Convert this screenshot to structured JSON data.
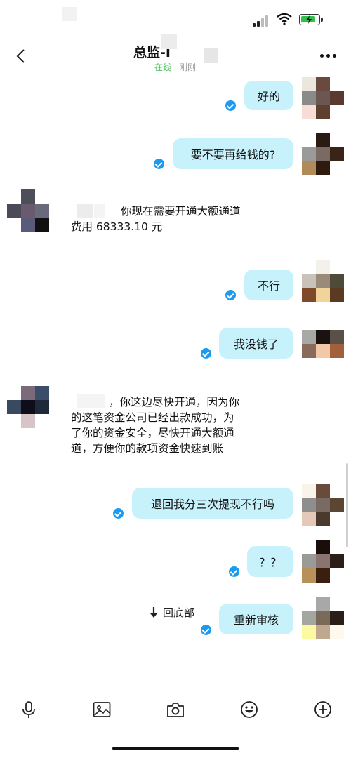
{
  "header": {
    "title": "总监-I",
    "online_status": "在线",
    "last_seen": "刚刚"
  },
  "messages": [
    {
      "side": "out",
      "text": "好的",
      "read": true
    },
    {
      "side": "out",
      "text": "要不要再给钱的?",
      "read": true
    },
    {
      "side": "in",
      "lines": [
        "你现在需要开通大额通道",
        "费用 68333.10 元"
      ]
    },
    {
      "side": "out",
      "text": "不行",
      "read": true
    },
    {
      "side": "out",
      "text": "我没钱了",
      "read": true
    },
    {
      "side": "in",
      "lines": [
        "，你这边尽快开通，因为你",
        "的这笔资金公司已经出款成功，为",
        "了你的资金安全，尽快开通大额通",
        "道，方便你的款项资金快速到账"
      ]
    },
    {
      "side": "out",
      "text": "退回我分三次提现不行吗",
      "read": true
    },
    {
      "side": "out",
      "text": "？？",
      "read": true
    },
    {
      "side": "out",
      "text": "重新审核",
      "read": true
    }
  ],
  "jump_to_bottom": "回底部",
  "toolbar": {
    "icons": [
      "microphone-icon",
      "image-icon",
      "camera-icon",
      "emoji-icon",
      "plus-icon"
    ]
  },
  "colors": {
    "bubble_out": "#c7f2fb",
    "read_tick": "#1a9bef",
    "online": "#4cc45b"
  }
}
